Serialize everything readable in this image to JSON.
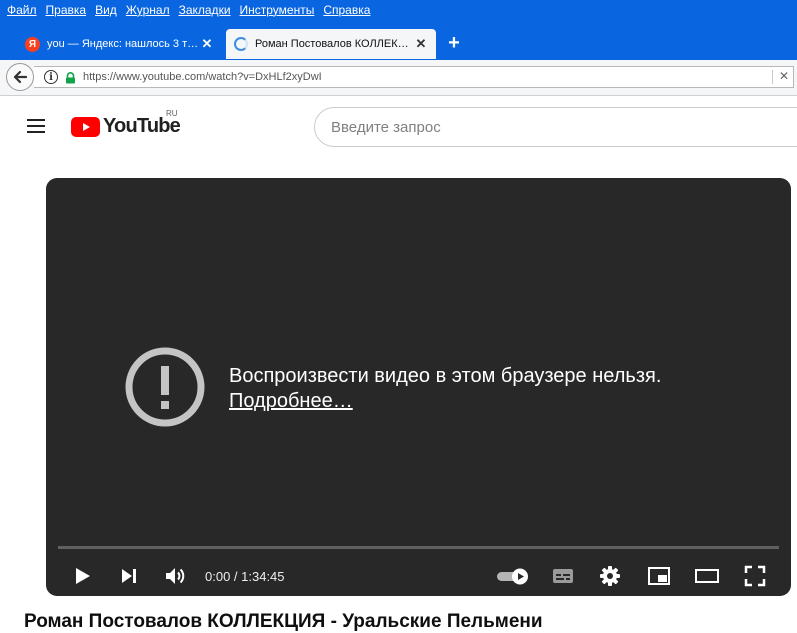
{
  "menu": [
    "Файл",
    "Правка",
    "Вид",
    "Журнал",
    "Закладки",
    "Инструменты",
    "Справка"
  ],
  "tabs": [
    {
      "title": "you — Яндекс: нашлось 3 т…",
      "icon": "yandex-icon",
      "active": false
    },
    {
      "title": "Роман Постовалов КОЛЛЕК…",
      "icon": "loading-icon",
      "active": true
    }
  ],
  "new_tab_label": "+",
  "address": {
    "url": "https://www.youtube.com/watch?v=DxHLf2xyDwI"
  },
  "youtube": {
    "wordmark": "YouTube",
    "region": "RU",
    "search_placeholder": "Введите запрос"
  },
  "player": {
    "error_title": "Воспроизвести видео в этом браузере нельзя.",
    "error_link": "Подробнее…",
    "time": "0:00 / 1:34:45",
    "progress": 0,
    "autoplay_on": true
  },
  "video_title": "Роман Постовалов КОЛЛЕКЦИЯ - Уральские Пельмени",
  "colors": {
    "browser_chrome": "#0a66e0",
    "yt_red": "#ff0000",
    "player_bg": "#282828"
  }
}
